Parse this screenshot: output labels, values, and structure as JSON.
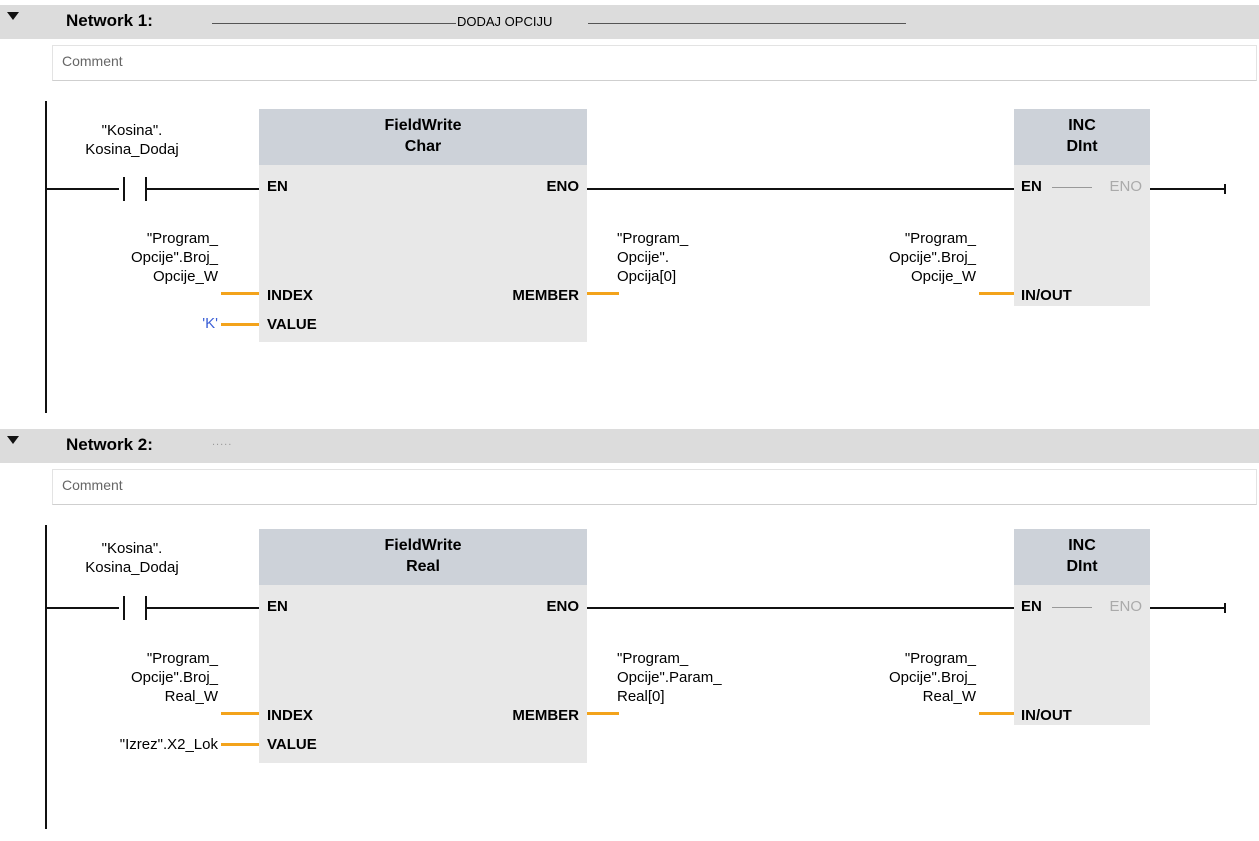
{
  "networks": [
    {
      "title": "Network 1:",
      "description": "DODAJ OPCIJU",
      "comment": "Comment",
      "contact_label": [
        "\"Kosina\".",
        "Kosina_Dodaj"
      ],
      "fieldwrite": {
        "name": "FieldWrite",
        "type": "Char",
        "pin_en": "EN",
        "pin_eno": "ENO",
        "pin_index": "INDEX",
        "pin_value": "VALUE",
        "pin_member": "MEMBER",
        "index_operand": [
          "\"Program_",
          "Opcije\".Broj_",
          "Opcije_W"
        ],
        "value_operand": "'K'",
        "member_operand": [
          "\"Program_",
          "Opcije\".",
          "Opcija[0]"
        ]
      },
      "inc": {
        "name": "INC",
        "type": "DInt",
        "pin_en": "EN",
        "pin_eno": "ENO",
        "pin_inout": "IN/OUT",
        "inout_operand": [
          "\"Program_",
          "Opcije\".Broj_",
          "Opcije_W"
        ]
      }
    },
    {
      "title": "Network 2:",
      "description": ".....",
      "comment": "Comment",
      "contact_label": [
        "\"Kosina\".",
        "Kosina_Dodaj"
      ],
      "fieldwrite": {
        "name": "FieldWrite",
        "type": "Real",
        "pin_en": "EN",
        "pin_eno": "ENO",
        "pin_index": "INDEX",
        "pin_value": "VALUE",
        "pin_member": "MEMBER",
        "index_operand": [
          "\"Program_",
          "Opcije\".Broj_",
          "Real_W"
        ],
        "value_operand": "\"Izrez\".X2_Lok",
        "member_operand": [
          "\"Program_",
          "Opcije\".Param_",
          "Real[0]"
        ]
      },
      "inc": {
        "name": "INC",
        "type": "DInt",
        "pin_en": "EN",
        "pin_eno": "ENO",
        "pin_inout": "IN/OUT",
        "inout_operand": [
          "\"Program_",
          "Opcije\".Broj_",
          "Real_W"
        ]
      }
    }
  ],
  "colors": {
    "header_bg": "#dcdcdc",
    "block_head": "#cdd2d9",
    "block_body": "#e8e8e8",
    "wire": "#111111",
    "param_wire": "#f3a31b",
    "constant": "#3b5fd6"
  },
  "icons": {
    "collapse": "triangle-down-icon"
  }
}
